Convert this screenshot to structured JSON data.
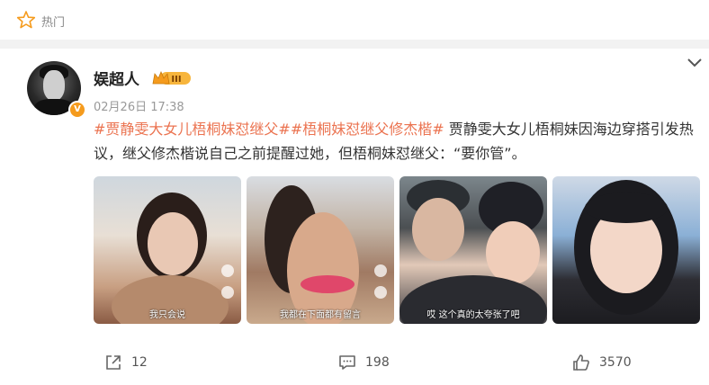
{
  "topbar": {
    "label": "热门"
  },
  "post": {
    "username": "娱超人",
    "level_badge": "III",
    "verified_badge": "V",
    "timestamp": "02月26日 17:38",
    "hashtag1": "#贾静雯大女儿梧桐妹怼继父#",
    "hashtag2": "#梧桐妹怼继父修杰楷#",
    "body": " 贾静雯大女儿梧桐妹因海边穿搭引发热议，继父修杰楷说自己之前提醒过她，但梧桐妹怼继父：“要你管”。",
    "images": [
      {
        "caption": "我只会说"
      },
      {
        "caption": "我都在下面都有留言"
      },
      {
        "caption": "哎 这个真的太夸张了吧"
      },
      {
        "caption": ""
      }
    ]
  },
  "actions": {
    "share_count": "12",
    "comment_count": "198",
    "like_count": "3570"
  },
  "colors": {
    "hashtag": "#eb7350",
    "accent": "#f59b1d"
  },
  "icons": [
    "hot-icon",
    "chevron-down-icon",
    "share-icon",
    "comment-icon",
    "like-icon"
  ]
}
